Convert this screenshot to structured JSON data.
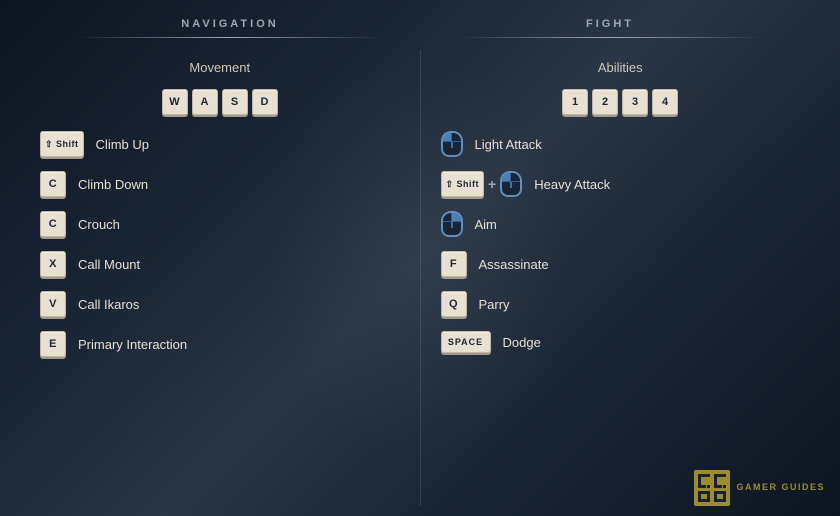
{
  "sections": {
    "nav": {
      "label": "NAVIGATION",
      "movement": {
        "title": "Movement",
        "keys": [
          "W",
          "A",
          "S",
          "D"
        ]
      },
      "bindings": [
        {
          "key": "⇧Shift",
          "isShift": true,
          "action": "Climb Up"
        },
        {
          "key": "C",
          "action": "Climb Down"
        },
        {
          "key": "C",
          "action": "Crouch"
        },
        {
          "key": "X",
          "action": "Call Mount"
        },
        {
          "key": "V",
          "action": "Call Ikaros"
        },
        {
          "key": "E",
          "action": "Primary Interaction"
        }
      ]
    },
    "fight": {
      "label": "FIGHT",
      "abilities": {
        "title": "Abilities",
        "keys": [
          "1",
          "2",
          "3",
          "4"
        ]
      },
      "bindings": [
        {
          "icon": "mouse-left",
          "action": "Light Attack"
        },
        {
          "icon": "shift-mouse-left",
          "action": "Heavy Attack"
        },
        {
          "icon": "mouse-right",
          "action": "Aim"
        },
        {
          "key": "F",
          "action": "Assassinate"
        },
        {
          "key": "Q",
          "action": "Parry"
        },
        {
          "icon": "spacebar",
          "action": "Dodge"
        }
      ]
    }
  },
  "logo": {
    "text": "GAMER\nGUIDES"
  }
}
